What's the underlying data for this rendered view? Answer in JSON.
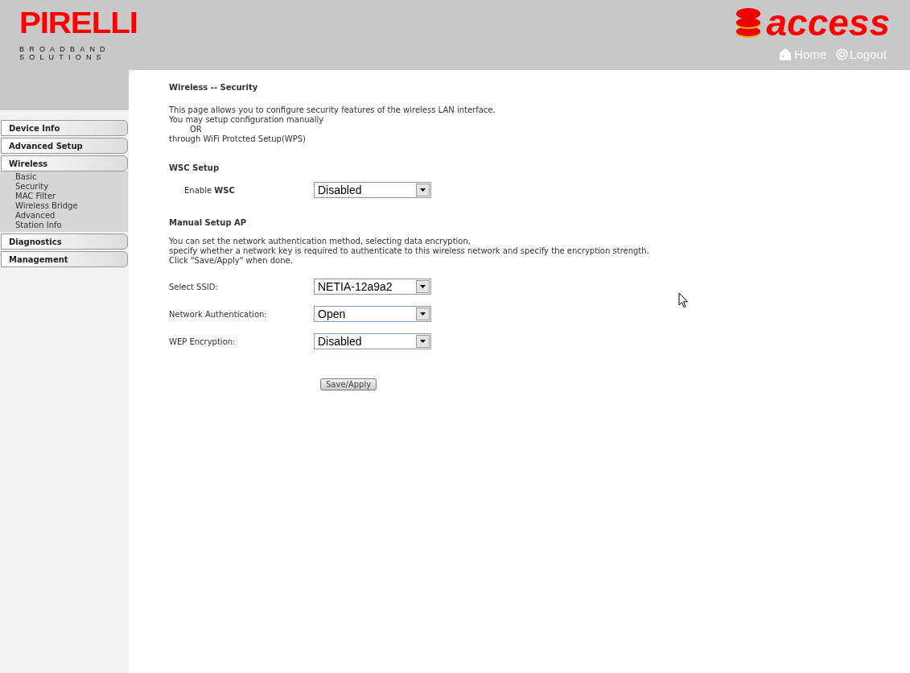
{
  "header": {
    "logo": {
      "brand": "PIRELLI",
      "line_1": "BROADBAND",
      "line_2": "SOLUTIONS"
    },
    "product_logo": "access",
    "links": [
      {
        "kind": "home",
        "label": "Home"
      },
      {
        "kind": "logout",
        "label": "Logout"
      }
    ]
  },
  "sidebar": {
    "items": [
      {
        "label": "Device Info",
        "expanded": false
      },
      {
        "label": "Advanced Setup",
        "expanded": false
      },
      {
        "label": "Wireless",
        "expanded": true,
        "children": [
          {
            "label": "Basic"
          },
          {
            "label": "Security"
          },
          {
            "label": "MAC Filter"
          },
          {
            "label": "Wireless Bridge"
          },
          {
            "label": "Advanced"
          },
          {
            "label": "Station Info"
          }
        ]
      },
      {
        "label": "Diagnostics",
        "expanded": false
      },
      {
        "label": "Management",
        "expanded": false
      }
    ]
  },
  "page": {
    "title": "Wireless -- Security",
    "intro": [
      "This page allows you to configure security features of the wireless LAN interface.",
      "You may setup configuration manually",
      "OR",
      "through WiFi Protcted Setup(WPS)"
    ],
    "sections": [
      {
        "heading": "WSC Setup",
        "fields": [
          {
            "label": "Enable **WSC**",
            "value": "Disabled"
          }
        ]
      },
      {
        "heading": "Manual Setup AP",
        "description": [
          "You can set the network authentication method, selecting data encryption,",
          "specify whether a network key is required to authenticate to this wireless network and specify the encryption strength.",
          "Click \"Save/Apply\" when done."
        ],
        "fields": [
          {
            "label": "Select SSID:",
            "value": "NETIA-12a9a2"
          },
          {
            "label": "Network Authentication:",
            "value": "Open"
          },
          {
            "label": "WEP Encryption:",
            "value": "Disabled"
          }
        ]
      }
    ],
    "button": "Save/Apply"
  }
}
